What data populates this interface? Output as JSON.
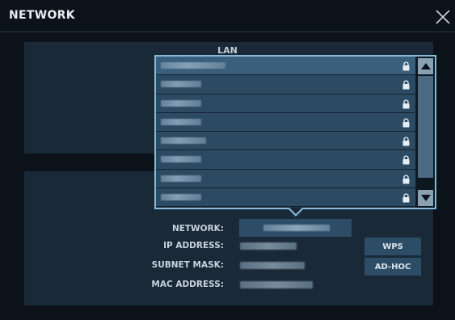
{
  "window": {
    "title": "NETWORK",
    "close_icon": "close-x-icon"
  },
  "lan": {
    "label": "LAN"
  },
  "networks": [
    {
      "ssid": "██████ ████ █",
      "secured": true,
      "selected": true
    },
    {
      "ssid": "████████",
      "secured": true,
      "selected": false
    },
    {
      "ssid": "███ █████",
      "secured": true,
      "selected": false
    },
    {
      "ssid": "███ █████",
      "secured": true,
      "selected": false
    },
    {
      "ssid": "██ ████ ███",
      "secured": true,
      "selected": false
    },
    {
      "ssid": "████████",
      "secured": true,
      "selected": false
    },
    {
      "ssid": "███ █████",
      "secured": true,
      "selected": false
    },
    {
      "ssid": "███ █████",
      "secured": true,
      "selected": false
    }
  ],
  "details": {
    "network_label": "NETWORK:",
    "network_value": "███████████████",
    "ip_label": "IP ADDRESS:",
    "ip_value": "█████████",
    "subnet_label": "SUBNET MASK:",
    "subnet_value": "█████████",
    "mac_label": "MAC ADDRESS:",
    "mac_value": "██████████████"
  },
  "buttons": {
    "wps": "WPS",
    "adhoc": "AD-HOC"
  },
  "colors": {
    "accent": "#86b8d8",
    "row": "#2c4b63",
    "panel": "#1a2937",
    "background": "#0b1219"
  }
}
